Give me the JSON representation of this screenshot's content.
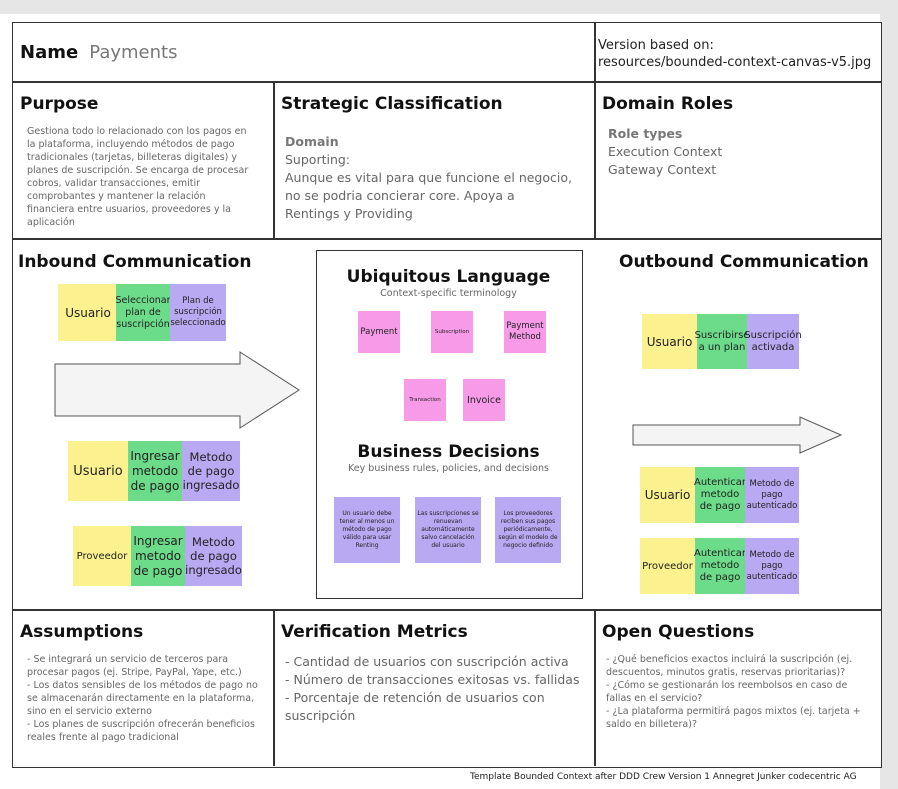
{
  "name": {
    "label": "Name",
    "value": "Payments"
  },
  "version": {
    "label": "Version based on:",
    "value": "resources/bounded-context-canvas-v5.jpg"
  },
  "purpose": {
    "title": "Purpose",
    "text": "Gestiona todo lo relacionado con los pagos en la plataforma, incluyendo métodos de pago tradicionales (tarjetas, billeteras digitales) y planes de suscripción. Se encarga de procesar cobros, validar transacciones, emitir comprobantes y mantener la relación financiera entre usuarios, proveedores y la aplicación"
  },
  "strategic": {
    "title": "Strategic Classification",
    "subtitle": "Domain",
    "lines": [
      "Suporting:",
      "Aunque es vital para que funcione el negocio,",
      "no se podria concierar core. Apoya a",
      "Rentings y Providing"
    ]
  },
  "domain_roles": {
    "title": "Domain Roles",
    "subtitle": "Role types",
    "items": [
      "Execution Context",
      "Gateway Context"
    ]
  },
  "inbound": {
    "title": "Inbound Communication",
    "groups": [
      {
        "actor": "Usuario",
        "action": "Seleccionar plan de suscripción",
        "result": "Plan de suscripción seleccionado"
      },
      {
        "actor": "Usuario",
        "action": "Ingresar metodo de pago",
        "result": "Metodo de pago ingresado"
      },
      {
        "actor": "Proveedor",
        "action": "Ingresar metodo de pago",
        "result": "Metodo de pago ingresado"
      }
    ]
  },
  "ubiquitous": {
    "title": "Ubiquitous Language",
    "subtitle": "Context-specific terminology",
    "terms": [
      "Payment",
      "Subscription",
      "Payment Method",
      "Transaction",
      "Invoice"
    ]
  },
  "business": {
    "title": "Business Decisions",
    "subtitle": "Key business rules, policies, and decisions",
    "rules": [
      "Un usuario debe tener al menos un método de pago válido para usar Renting",
      "Las suscripciones se renuevan automáticamente salvo cancelación del usuario",
      "Los proveedores reciben sus pagos periódicamente, según el modelo de negocio definido"
    ]
  },
  "outbound": {
    "title": "Outbound Communication",
    "groups": [
      {
        "actor": "Usuario",
        "action": "Suscribirse a un plan",
        "result": "Suscripción activada"
      },
      {
        "actor": "Usuario",
        "action": "Autenticar metodo de pago",
        "result": "Metodo de pago autenticado"
      },
      {
        "actor": "Proveedor",
        "action": "Autenticar metodo de pago",
        "result": "Metodo de pago autenticado"
      }
    ]
  },
  "assumptions": {
    "title": "Assumptions",
    "items": [
      "- Se integrará un servicio de terceros para procesar pagos (ej. Stripe, PayPal, Yape, etc.)",
      "- Los datos sensibles de los métodos de pago no se almacenarán directamente en la plataforma, sino en el servicio externo",
      "- Los planes de suscripción ofrecerán beneficios reales frente al pago tradicional"
    ]
  },
  "metrics": {
    "title": "Verification Metrics",
    "items": [
      "- Cantidad de usuarios con suscripción activa",
      "- Número de transacciones exitosas vs. fallidas",
      "- Porcentaje de retención de usuarios con suscripción"
    ]
  },
  "questions": {
    "title": "Open Questions",
    "items": [
      "- ¿Qué beneficios exactos incluirá la suscripción (ej. descuentos, minutos gratis, reservas prioritarias)?",
      "- ¿Cómo se gestionarán los reembolsos en caso de fallas en el servicio?",
      "- ¿La plataforma permitirá pagos mixtos (ej. tarjeta + saldo en billetera)?"
    ]
  },
  "footer": "Template Bounded Context after DDD Crew Version 1 Annegret Junker codecentric AG",
  "colors": {
    "yellow": "#fbf28f",
    "green": "#6cdb8a",
    "purple": "#b9a8f2",
    "pink": "#f79be9"
  }
}
